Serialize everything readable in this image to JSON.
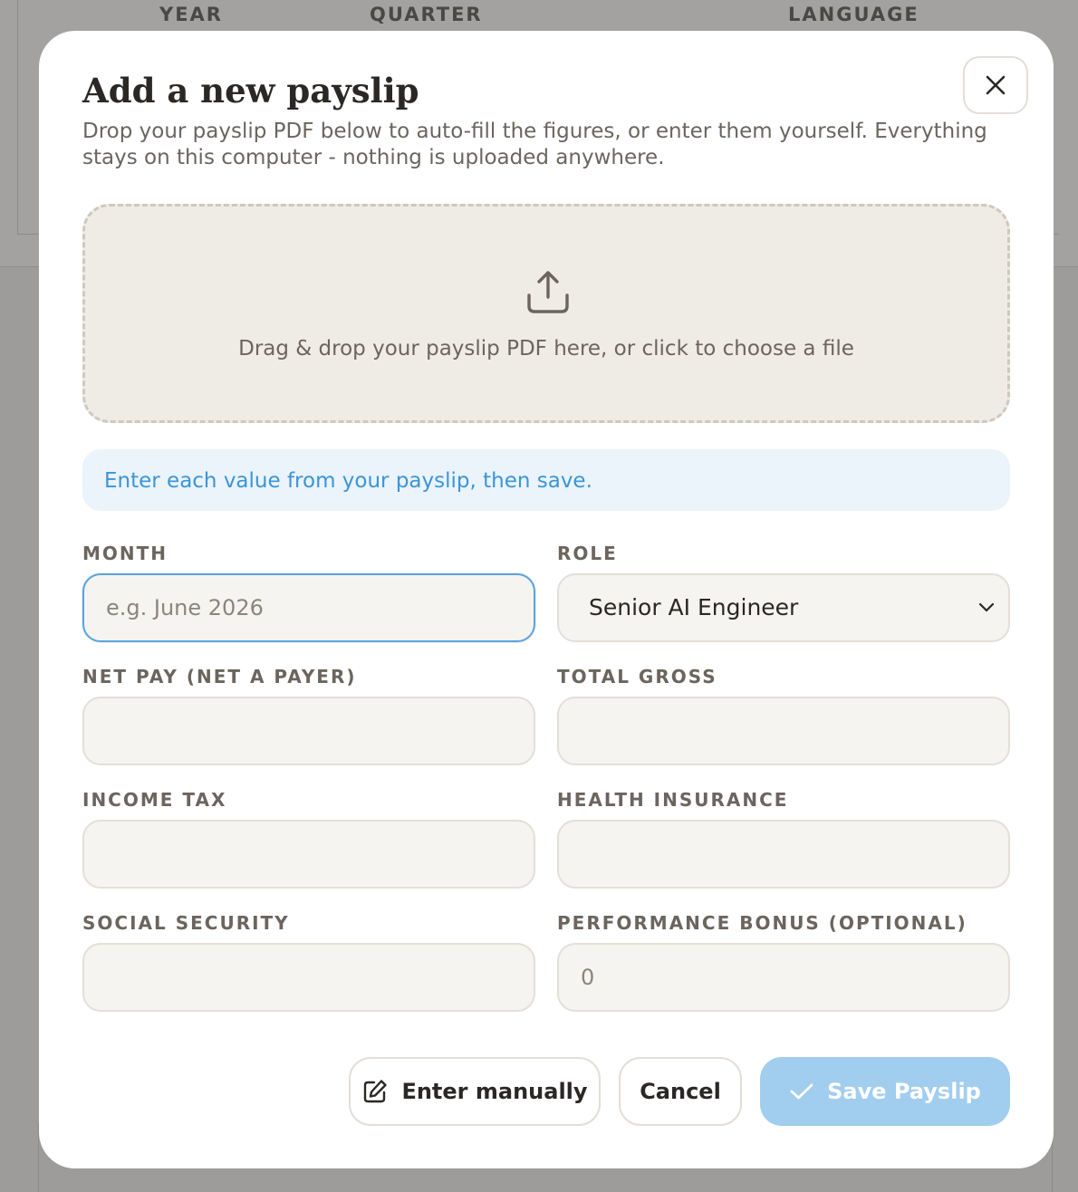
{
  "background": {
    "columns": [
      "YEAR",
      "QUARTER",
      "LANGUAGE"
    ]
  },
  "modal": {
    "title": "Add a new payslip",
    "subtitle": "Drop your payslip PDF below to auto-fill the figures, or enter them yourself. Everything stays on this computer - nothing is uploaded anywhere.",
    "dropzone_text": "Drag & drop your payslip PDF here, or click to choose a file",
    "info_banner": "Enter each value from your payslip, then save.",
    "fields": {
      "month": {
        "label": "MONTH",
        "placeholder": "e.g. June 2026",
        "value": ""
      },
      "role": {
        "label": "ROLE",
        "value": "Senior AI Engineer"
      },
      "net_pay": {
        "label": "NET PAY (NET A PAYER)",
        "value": ""
      },
      "total_gross": {
        "label": "TOTAL GROSS",
        "value": ""
      },
      "income_tax": {
        "label": "INCOME TAX",
        "value": ""
      },
      "health_insurance": {
        "label": "HEALTH INSURANCE",
        "value": ""
      },
      "social_security": {
        "label": "SOCIAL SECURITY",
        "value": ""
      },
      "performance_bonus": {
        "label": "PERFORMANCE BONUS (OPTIONAL)",
        "placeholder": "0",
        "value": ""
      }
    },
    "buttons": {
      "enter_manually": "Enter manually",
      "cancel": "Cancel",
      "save": "Save Payslip"
    },
    "icons": {
      "close": "close-icon",
      "upload": "upload-icon",
      "edit": "edit-icon",
      "check": "check-icon",
      "chevron": "chevron-down-icon"
    },
    "colors": {
      "accent": "#3b95d8",
      "save_button_disabled": "#a1cdef",
      "focus_border": "#5aa3dc",
      "dropzone_bg": "#efebe5"
    }
  }
}
